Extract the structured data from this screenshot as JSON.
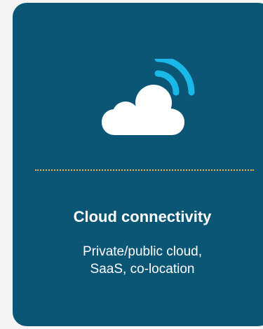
{
  "card": {
    "title": "Cloud connectivity",
    "description_lines": [
      "Private/public cloud,",
      "SaaS, co-location"
    ],
    "icon": "cloud-wifi-icon"
  },
  "colors": {
    "background": "#f4f4f3",
    "card": "#0b5575",
    "signal": "#19b8e8",
    "divider": "#f0b23a",
    "text": "#ffffff"
  }
}
